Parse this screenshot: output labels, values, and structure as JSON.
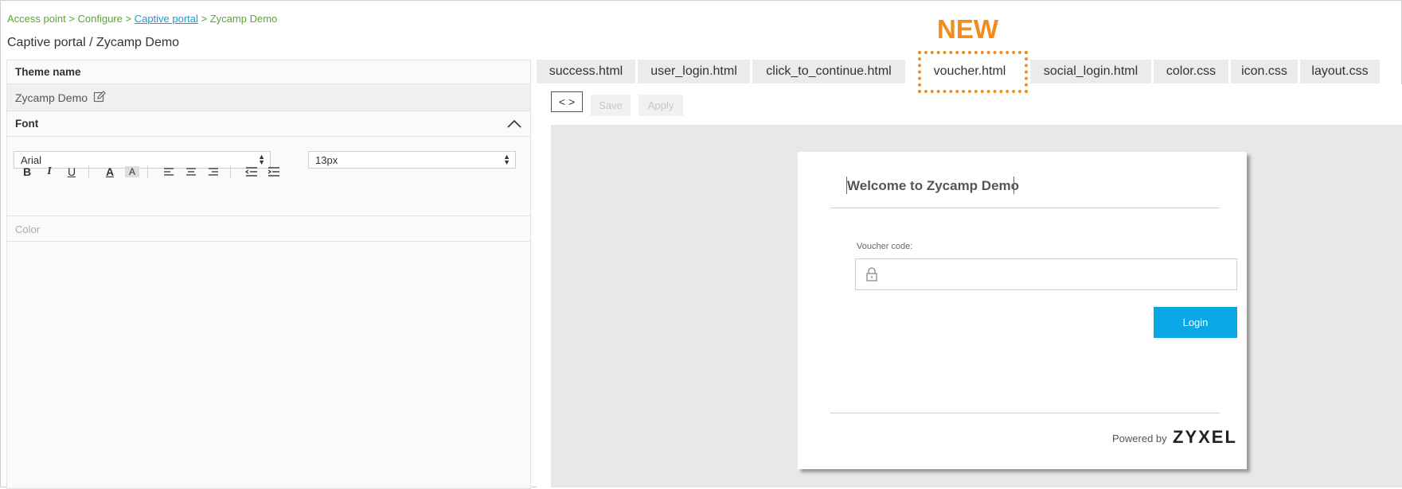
{
  "breadcrumb": {
    "part1": "Access point > Configure > ",
    "link": "Captive portal",
    "part3": " > Zycamp Demo"
  },
  "page_title": "Captive portal  /  Zycamp Demo",
  "left_panel": {
    "theme_name_label": "Theme name",
    "theme_name_value": "Zycamp Demo",
    "font_label": "Font",
    "font_family": "Arial",
    "font_size": "13px",
    "toolbar": {
      "bold": "B",
      "italic": "I",
      "underline": "U",
      "font_color": "A",
      "highlight": "A"
    },
    "color_label": "Color"
  },
  "new_label": "NEW",
  "tabs": [
    {
      "label": "success.html"
    },
    {
      "label": "user_login.html"
    },
    {
      "label": "click_to_continue.html"
    },
    {
      "label": "voucher.html",
      "active": true
    },
    {
      "label": "social_login.html"
    },
    {
      "label": "color.css"
    },
    {
      "label": "icon.css"
    },
    {
      "label": "layout.css"
    }
  ],
  "editor": {
    "code_toggle": "< >",
    "save_label": "Save",
    "apply_label": "Apply"
  },
  "preview": {
    "welcome_title": "Welcome to Zycamp Demo",
    "voucher_label": "Voucher code:",
    "voucher_value": "",
    "login_label": "Login",
    "powered_by": "Powered by",
    "brand": "ZYXEL"
  },
  "colors": {
    "accent_orange": "#f28c1e",
    "login_blue": "#0aa6e6",
    "breadcrumb_green": "#5aa62f",
    "link_blue": "#1d9bd7"
  }
}
